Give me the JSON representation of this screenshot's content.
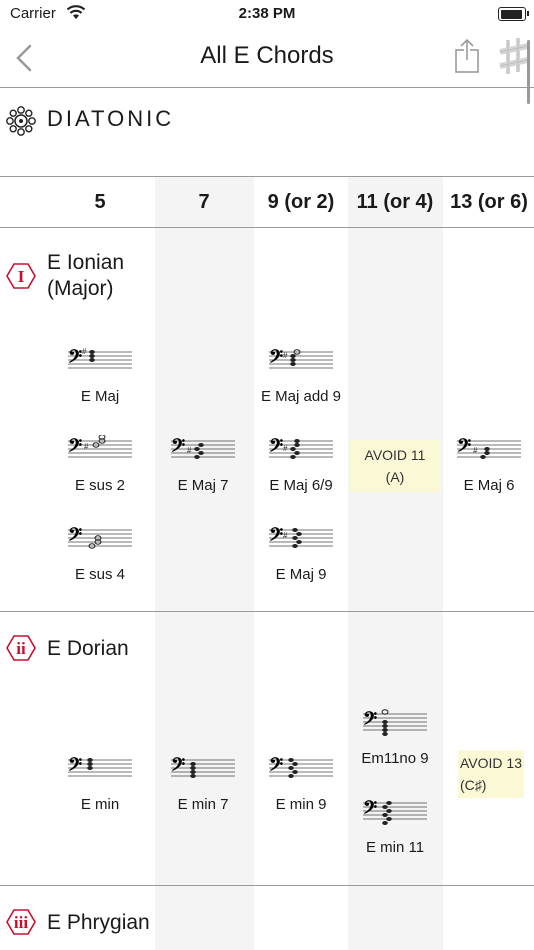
{
  "status_bar": {
    "carrier": "Carrier",
    "time": "2:38 PM"
  },
  "nav": {
    "title": "All E Chords"
  },
  "section": {
    "label": "DIATONIC"
  },
  "columns": [
    "5",
    "7",
    "9 (or 2)",
    "11 (or 4)",
    "13 (or 6)"
  ],
  "modes": [
    {
      "badge": "I",
      "name": "E Ionian\n(Major)"
    },
    {
      "badge": "ii",
      "name": "E Dorian"
    },
    {
      "badge": "iii",
      "name": "E Phrygian"
    }
  ],
  "chords": {
    "ionian": {
      "c5_a": "E Maj",
      "c5_b": "E sus 2",
      "c5_c": "E sus 4",
      "c7_a": "E Maj 7",
      "c9_a": "E Maj add 9",
      "c9_b": "E Maj 6/9",
      "c9_c": "E Maj 9",
      "c11_avoid": "AVOID 11 (A)",
      "c13_a": "E Maj 6"
    },
    "dorian": {
      "c5_a": "E min",
      "c7_a": "E min 7",
      "c9_a": "E min 9",
      "c11_a": "Em11no 9",
      "c11_b": "E min 11",
      "c13_avoid": "AVOID 13\n(C♯)"
    }
  },
  "colors": {
    "accent_red": "#c8102e",
    "column_shade": "#f4f4f4",
    "avoid_bg": "#fbf8d6",
    "rule": "#9a9a9a"
  },
  "icons": [
    "wifi-icon",
    "battery-icon",
    "back-chevron-icon",
    "share-icon",
    "sharp-icon",
    "circle-of-fifths-icon",
    "bass-clef-icon"
  ]
}
